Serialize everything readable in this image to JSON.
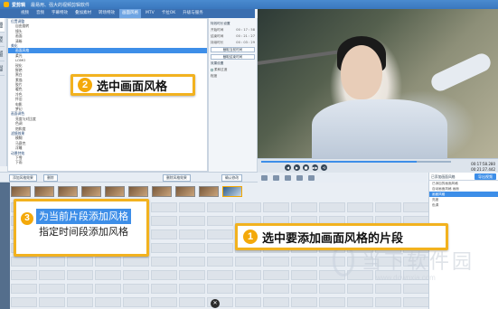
{
  "window": {
    "app_title": "爱剪辑",
    "subtitle": "最易用、强大的视频剪辑软件"
  },
  "menu_tabs": [
    {
      "label": "视频",
      "active": false
    },
    {
      "label": "音频",
      "active": false
    },
    {
      "label": "字幕特效",
      "active": false
    },
    {
      "label": "叠加素材",
      "active": false
    },
    {
      "label": "转场特效",
      "active": false
    },
    {
      "label": "画面风格",
      "active": true
    },
    {
      "label": "MTV",
      "active": false
    },
    {
      "label": "卡拉OK",
      "active": false
    },
    {
      "label": "升级与服务",
      "active": false
    }
  ],
  "vtabs": [
    "画面",
    "美化",
    "滤镜",
    "动景"
  ],
  "tree": [
    {
      "label": "位置调整",
      "kind": "group"
    },
    {
      "label": "自由旋转",
      "kind": "item"
    },
    {
      "label": "镜头",
      "kind": "item"
    },
    {
      "label": "画面",
      "kind": "item"
    },
    {
      "label": "清晰",
      "kind": "item"
    },
    {
      "label": "美化",
      "kind": "group"
    },
    {
      "label": "画面风格",
      "kind": "item",
      "selected": true
    },
    {
      "label": "柔光",
      "kind": "item"
    },
    {
      "label": "LOMO",
      "kind": "item"
    },
    {
      "label": "锐化",
      "kind": "item"
    },
    {
      "label": "鲜艳",
      "kind": "item"
    },
    {
      "label": "黑白",
      "kind": "item"
    },
    {
      "label": "素描",
      "kind": "item"
    },
    {
      "label": "胶片",
      "kind": "item"
    },
    {
      "label": "暖色",
      "kind": "item"
    },
    {
      "label": "冷色",
      "kind": "item"
    },
    {
      "label": "怀旧",
      "kind": "item"
    },
    {
      "label": "电影",
      "kind": "item"
    },
    {
      "label": "梦幻",
      "kind": "item"
    },
    {
      "label": "画面调色",
      "kind": "group"
    },
    {
      "label": "亮度与对比度",
      "kind": "item"
    },
    {
      "label": "色调",
      "kind": "item"
    },
    {
      "label": "饱和度",
      "kind": "item"
    },
    {
      "label": "滤镜效果",
      "kind": "group"
    },
    {
      "label": "模糊",
      "kind": "item"
    },
    {
      "label": "马赛克",
      "kind": "item"
    },
    {
      "label": "浮雕",
      "kind": "item"
    },
    {
      "label": "动景特效",
      "kind": "group"
    },
    {
      "label": "下雪",
      "kind": "item"
    },
    {
      "label": "下雨",
      "kind": "item"
    }
  ],
  "settings": {
    "time_section": "特效时长设置",
    "start_label": "开始时间",
    "start_value": "00 : 17 : 58",
    "end_label": "结束时间",
    "end_value": "00 : 21 : 27",
    "duration_label": "持续时长",
    "duration_value": "00 : 03 : 29",
    "btn_current": "截取当前时间",
    "btn_end": "截取结束时间",
    "effect_section": "效果设置",
    "checkbox_label": "柔和过渡",
    "degree_label": "程度"
  },
  "toolbar": {
    "add_style_label": "添加风格效果",
    "delete_label": "删除",
    "apply_btn": "确认修改",
    "delete_style_btn": "删除风格效果"
  },
  "player": {
    "progress": 0.82,
    "time_current": "00:17:58.280",
    "time_total": "00:21:27.442",
    "controls": [
      "◀",
      "▶",
      "■",
      "▶▶",
      "⟲"
    ]
  },
  "timeline": {
    "thumb_captions": [
      "part3",
      "part4",
      "part5"
    ]
  },
  "side_list": {
    "header": "已添加画面风格",
    "export_btn": "导出视频",
    "items": [
      {
        "label": "已添加的画面风格",
        "selected": false
      },
      {
        "label": "自动画面风格 画面",
        "selected": false
      },
      {
        "label": "画面风格",
        "selected": true
      },
      {
        "label": "亮度",
        "selected": false
      },
      {
        "label": "色调",
        "selected": false
      }
    ]
  },
  "callouts": {
    "step1": {
      "badge": "1",
      "text": "选中要添加画面风格的片段"
    },
    "step2": {
      "badge": "2",
      "text": "选中画面风格"
    },
    "step3": {
      "badge": "3",
      "items": [
        "为当前片段添加风格",
        "指定时间段添加风格"
      ]
    }
  },
  "watermark": {
    "brand": "当下软件园",
    "url": "www.downxia.com"
  },
  "colors": {
    "accent": "#3d8ee8",
    "callout_border": "#f2b21f",
    "badge": "#f4a90a"
  }
}
